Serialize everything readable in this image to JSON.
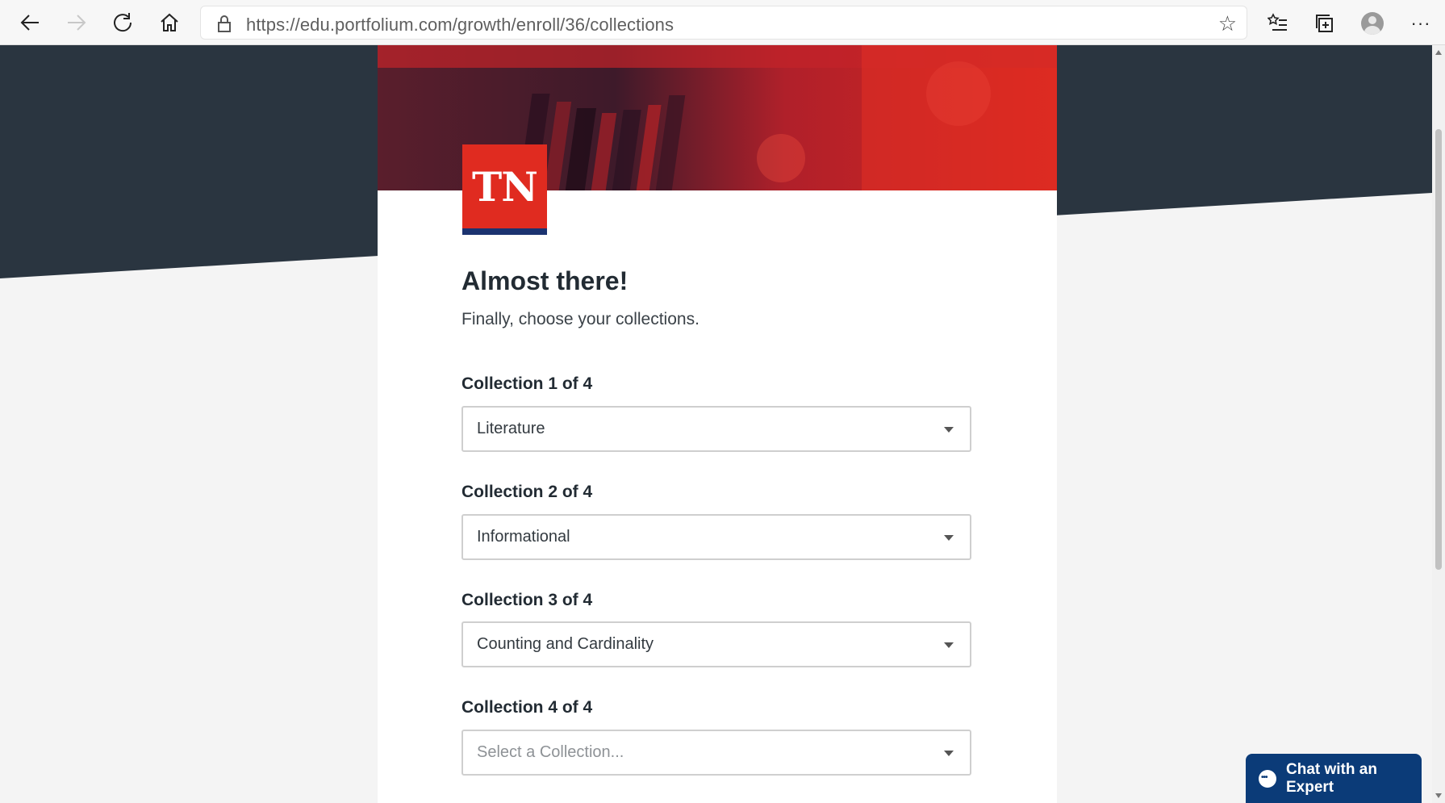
{
  "browser": {
    "url": "https://edu.portfolium.com/growth/enroll/36/collections",
    "icons": [
      "back-arrow-icon",
      "forward-arrow-icon",
      "refresh-icon",
      "home-icon",
      "lock-icon",
      "star-icon",
      "favorites-icon",
      "collections-icon",
      "profile-icon",
      "more-icon"
    ]
  },
  "colors": {
    "backdrop_dark": "#2a3540",
    "page_bg": "#f4f4f4",
    "logo_red": "#e02b20",
    "logo_underline": "#1b3370",
    "chat_blue": "#0b3b78"
  },
  "logo": {
    "text": "TN"
  },
  "form": {
    "heading": "Almost there!",
    "subheading": "Finally, choose your collections.",
    "collections": [
      {
        "label": "Collection 1 of 4",
        "value": "Literature"
      },
      {
        "label": "Collection 2 of 4",
        "value": "Informational"
      },
      {
        "label": "Collection 3 of 4",
        "value": "Counting and Cardinality"
      },
      {
        "label": "Collection 4 of 4",
        "placeholder": "Select a Collection..."
      }
    ]
  },
  "chat": {
    "label": "Chat with an Expert"
  }
}
